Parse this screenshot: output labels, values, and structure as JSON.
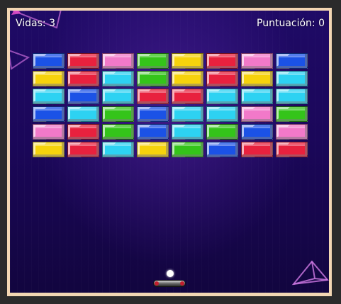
{
  "hud": {
    "lives_label": "Vidas: 3",
    "score_label": "Puntuación: 0"
  },
  "colors": {
    "blue": "#1b52e6",
    "red": "#e8213e",
    "pink": "#f279c9",
    "green": "#34c41a",
    "yellow": "#f6d20c",
    "cyan": "#2dd2f2"
  },
  "bricks": [
    [
      "blue",
      "red",
      "pink",
      "green",
      "yellow",
      "red",
      "pink",
      "blue"
    ],
    [
      "yellow",
      "red",
      "cyan",
      "green",
      "yellow",
      "red",
      "yellow",
      "cyan"
    ],
    [
      "cyan",
      "blue",
      "cyan",
      "red",
      "red",
      "cyan",
      "cyan",
      "cyan"
    ],
    [
      "blue",
      "cyan",
      "green",
      "blue",
      "cyan",
      "cyan",
      "pink",
      "green"
    ],
    [
      "pink",
      "red",
      "green",
      "blue",
      "cyan",
      "green",
      "blue",
      "pink"
    ],
    [
      "yellow",
      "red",
      "cyan",
      "yellow",
      "green",
      "blue",
      "red",
      "red"
    ]
  ],
  "game": {
    "lives": 3,
    "score": 0
  }
}
